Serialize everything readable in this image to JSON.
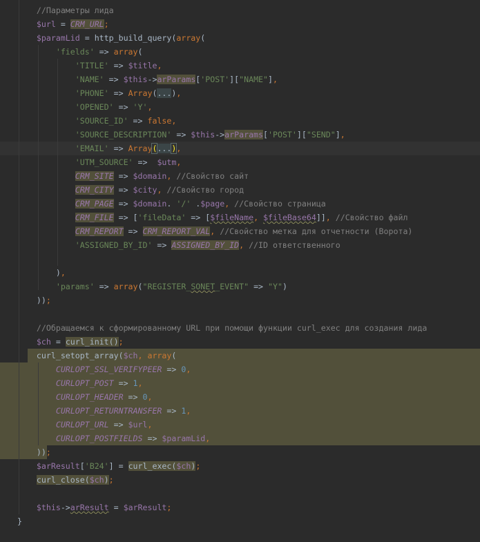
{
  "editor": {
    "theme_colors": {
      "background": "#2b2b2b",
      "keyword": "#cc7832",
      "string": "#6a8759",
      "variable": "#9876aa",
      "comment": "#808080",
      "number": "#6897bb",
      "highlight": "#52503a"
    },
    "lines": [
      [
        [
          "c",
          "    //Параметры лида"
        ]
      ],
      [
        [
          "d",
          "    "
        ],
        [
          "v",
          "$url"
        ],
        [
          "d",
          " = "
        ],
        [
          "i h",
          "CRM_URL"
        ],
        [
          "k",
          ";"
        ]
      ],
      [
        [
          "d",
          "    "
        ],
        [
          "v",
          "$paramLid"
        ],
        [
          "d",
          " = http_build_query("
        ],
        [
          "k",
          "array"
        ],
        [
          "d",
          "("
        ]
      ],
      [
        [
          "d",
          "        "
        ],
        [
          "s",
          "'fields'"
        ],
        [
          "d",
          " => "
        ],
        [
          "k",
          "array"
        ],
        [
          "d",
          "("
        ]
      ],
      [
        [
          "d",
          "            "
        ],
        [
          "s",
          "'TITLE'"
        ],
        [
          "d",
          " => "
        ],
        [
          "v",
          "$title"
        ],
        [
          "k",
          ","
        ]
      ],
      [
        [
          "d",
          "            "
        ],
        [
          "s",
          "'NAME'"
        ],
        [
          "d",
          " => "
        ],
        [
          "v",
          "$this"
        ],
        [
          "d",
          "->"
        ],
        [
          "f h",
          "arParams"
        ],
        [
          "d",
          "["
        ],
        [
          "s",
          "'POST'"
        ],
        [
          "d",
          "]["
        ],
        [
          "s",
          "\"NAME\""
        ],
        [
          "d",
          "]"
        ],
        [
          "k",
          ","
        ]
      ],
      [
        [
          "d",
          "            "
        ],
        [
          "s",
          "'PHONE'"
        ],
        [
          "d",
          " => "
        ],
        [
          "k",
          "Array"
        ],
        [
          "d",
          "("
        ],
        [
          "fold",
          "..."
        ],
        [
          "d",
          ")"
        ],
        [
          "k",
          ","
        ]
      ],
      [
        [
          "d",
          "            "
        ],
        [
          "s",
          "'OPENED'"
        ],
        [
          "d",
          " => "
        ],
        [
          "s",
          "'Y'"
        ],
        [
          "k",
          ","
        ]
      ],
      [
        [
          "d",
          "            "
        ],
        [
          "s",
          "'SOURCE_ID'"
        ],
        [
          "d",
          " => "
        ],
        [
          "k",
          "false,"
        ]
      ],
      [
        [
          "d",
          "            "
        ],
        [
          "s",
          "'SOURCE_DESCRIPTION'"
        ],
        [
          "d",
          " => "
        ],
        [
          "v",
          "$this"
        ],
        [
          "d",
          "->"
        ],
        [
          "f h",
          "arParams"
        ],
        [
          "d",
          "["
        ],
        [
          "s",
          "'POST'"
        ],
        [
          "d",
          "]["
        ],
        [
          "s",
          "\"SEND\""
        ],
        [
          "d",
          "]"
        ],
        [
          "k",
          ","
        ]
      ],
      [
        [
          "d",
          "            "
        ],
        [
          "s",
          "'EMAIL'"
        ],
        [
          "d",
          " => "
        ],
        [
          "k",
          "Array"
        ],
        [
          "bm",
          "("
        ],
        [
          "fold",
          "..."
        ],
        [
          "bm",
          ")"
        ],
        [
          "k",
          ","
        ]
      ],
      [
        [
          "d",
          "            "
        ],
        [
          "s",
          "'UTM_SOURCE'"
        ],
        [
          "d",
          " =>  "
        ],
        [
          "v",
          "$utm"
        ],
        [
          "k",
          ","
        ]
      ],
      [
        [
          "d",
          "            "
        ],
        [
          "i h",
          "CRM_SITE"
        ],
        [
          "d",
          " => "
        ],
        [
          "v",
          "$domain"
        ],
        [
          "k",
          ","
        ],
        [
          "c",
          " //Свойство сайт"
        ]
      ],
      [
        [
          "d",
          "            "
        ],
        [
          "i h",
          "CRM_CITY"
        ],
        [
          "d",
          " => "
        ],
        [
          "v",
          "$city"
        ],
        [
          "k",
          ","
        ],
        [
          "c",
          " //Свойство город"
        ]
      ],
      [
        [
          "d",
          "            "
        ],
        [
          "i h",
          "CRM_PAGE"
        ],
        [
          "d",
          " => "
        ],
        [
          "v",
          "$domain"
        ],
        [
          "d",
          ". "
        ],
        [
          "s",
          "'/'"
        ],
        [
          "d",
          " ."
        ],
        [
          "v",
          "$page"
        ],
        [
          "k",
          ","
        ],
        [
          "c",
          " //Свойство страница"
        ]
      ],
      [
        [
          "d",
          "            "
        ],
        [
          "i h",
          "CRM_FILE"
        ],
        [
          "d",
          " => ["
        ],
        [
          "s",
          "'fileData'"
        ],
        [
          "d",
          " => ["
        ],
        [
          "v w",
          "$fileName"
        ],
        [
          "k",
          ", "
        ],
        [
          "v w",
          "$fileBase64"
        ],
        [
          "d",
          "]]"
        ],
        [
          "k",
          ","
        ],
        [
          "c",
          " //Свойство файл"
        ]
      ],
      [
        [
          "d",
          "            "
        ],
        [
          "i h",
          "CRM_REPORT"
        ],
        [
          "d",
          " => "
        ],
        [
          "i h",
          "CRM_REPORT_VAL"
        ],
        [
          "k",
          ","
        ],
        [
          "c",
          " //Свойство метка для отчетности (Ворота)"
        ]
      ],
      [
        [
          "d",
          "            "
        ],
        [
          "s",
          "'ASSIGNED_BY_ID'"
        ],
        [
          "d",
          " => "
        ],
        [
          "i h",
          "ASSIGNED_BY_ID"
        ],
        [
          "k",
          ","
        ],
        [
          "c",
          " //ID ответственного"
        ]
      ],
      [],
      [
        [
          "d",
          "        )"
        ],
        [
          "k",
          ","
        ]
      ],
      [
        [
          "d",
          "        "
        ],
        [
          "s",
          "'params'"
        ],
        [
          "d",
          " => "
        ],
        [
          "k",
          "array"
        ],
        [
          "d",
          "("
        ],
        [
          "s",
          "\"REGISTER_"
        ],
        [
          "s w",
          "SONET"
        ],
        [
          "s",
          "_EVENT\""
        ],
        [
          "d",
          " => "
        ],
        [
          "s",
          "\"Y\""
        ],
        [
          "d",
          ")"
        ]
      ],
      [
        [
          "d",
          "    ))"
        ],
        [
          "k",
          ";"
        ]
      ],
      [],
      [
        [
          "c",
          "    //Обращаемся к сформированному URL при помощи функции curl_exec для создания лида"
        ]
      ],
      [
        [
          "d",
          "    "
        ],
        [
          "v",
          "$ch"
        ],
        [
          "d",
          " = "
        ],
        [
          "d h",
          "curl_init()"
        ],
        [
          "k",
          ";"
        ]
      ],
      [
        [
          "d",
          "    curl_setopt_array("
        ],
        [
          "v",
          "$ch"
        ],
        [
          "k",
          ", array"
        ],
        [
          "d",
          "("
        ]
      ],
      [
        [
          "d",
          "        "
        ],
        [
          "i",
          "CURLOPT_SSL_VERIFYPEER"
        ],
        [
          "d",
          " => "
        ],
        [
          "n",
          "0"
        ],
        [
          "k",
          ","
        ]
      ],
      [
        [
          "d",
          "        "
        ],
        [
          "i",
          "CURLOPT_POST"
        ],
        [
          "d",
          " => "
        ],
        [
          "n",
          "1"
        ],
        [
          "k",
          ","
        ]
      ],
      [
        [
          "d",
          "        "
        ],
        [
          "i",
          "CURLOPT_HEADER"
        ],
        [
          "d",
          " => "
        ],
        [
          "n",
          "0"
        ],
        [
          "k",
          ","
        ]
      ],
      [
        [
          "d",
          "        "
        ],
        [
          "i",
          "CURLOPT_RETURNTRANSFER"
        ],
        [
          "d",
          " => "
        ],
        [
          "n",
          "1"
        ],
        [
          "k",
          ","
        ]
      ],
      [
        [
          "d",
          "        "
        ],
        [
          "i",
          "CURLOPT_URL"
        ],
        [
          "d",
          " => "
        ],
        [
          "v",
          "$url"
        ],
        [
          "k",
          ","
        ]
      ],
      [
        [
          "d",
          "        "
        ],
        [
          "i",
          "CURLOPT_POSTFIELDS"
        ],
        [
          "d",
          " => "
        ],
        [
          "v",
          "$paramLid"
        ],
        [
          "k",
          ","
        ]
      ],
      [
        [
          "d",
          "    ))"
        ],
        [
          "k",
          ";"
        ]
      ],
      [
        [
          "d",
          "    "
        ],
        [
          "v",
          "$arResult"
        ],
        [
          "d",
          "["
        ],
        [
          "s",
          "'B24'"
        ],
        [
          "d",
          "] = "
        ],
        [
          "d h",
          "curl_exec("
        ],
        [
          "v h",
          "$ch"
        ],
        [
          "d h",
          ")"
        ],
        [
          "k",
          ";"
        ]
      ],
      [
        [
          "d",
          "    "
        ],
        [
          "d h",
          "curl_close("
        ],
        [
          "v h",
          "$ch"
        ],
        [
          "d h",
          ")"
        ],
        [
          "k",
          ";"
        ]
      ],
      [],
      [
        [
          "d",
          "    "
        ],
        [
          "v",
          "$this"
        ],
        [
          "d",
          "->"
        ],
        [
          "f w",
          "arResult"
        ],
        [
          "d",
          " = "
        ],
        [
          "v",
          "$arResult"
        ],
        [
          "k",
          ";"
        ]
      ],
      [
        [
          "d",
          "}"
        ]
      ]
    ]
  }
}
